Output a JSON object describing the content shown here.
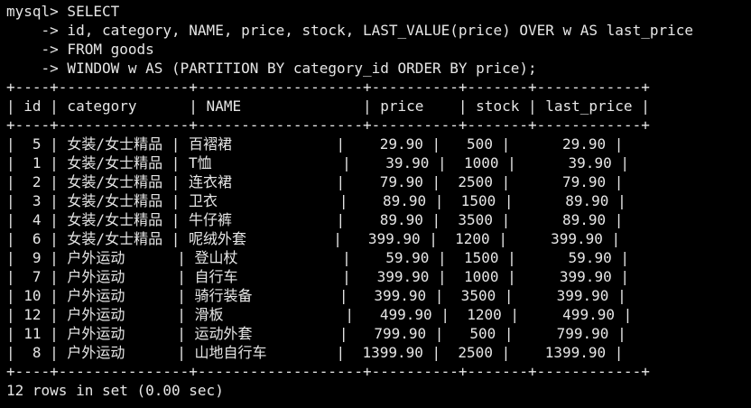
{
  "colors": {
    "background": "#000000",
    "text": "#e6e6e6"
  },
  "query": {
    "line1": "mysql> SELECT",
    "line2": "    -> id, category, NAME, price, stock, LAST_VALUE(price) OVER w AS last_price",
    "line3": "    -> FROM goods",
    "line4": "    -> WINDOW w AS (PARTITION BY category_id ORDER BY price);"
  },
  "table": {
    "border": "+----+---------------+-------------------+----------+-------+------------+",
    "columns": [
      "id",
      "category",
      "NAME",
      "price",
      "stock",
      "last_price"
    ],
    "header_line": "| id | category      | NAME              | price    | stock | last_price |",
    "rows": [
      {
        "id": "5",
        "category": "女装/女士精品",
        "name": "百褶裙",
        "price": "29.90",
        "stock": "500",
        "last_price": "29.90"
      },
      {
        "id": "1",
        "category": "女装/女士精品",
        "name": "T恤",
        "price": "39.90",
        "stock": "1000",
        "last_price": "39.90"
      },
      {
        "id": "2",
        "category": "女装/女士精品",
        "name": "连衣裙",
        "price": "79.90",
        "stock": "2500",
        "last_price": "79.90"
      },
      {
        "id": "3",
        "category": "女装/女士精品",
        "name": "卫衣",
        "price": "89.90",
        "stock": "1500",
        "last_price": "89.90"
      },
      {
        "id": "4",
        "category": "女装/女士精品",
        "name": "牛仔裤",
        "price": "89.90",
        "stock": "3500",
        "last_price": "89.90"
      },
      {
        "id": "6",
        "category": "女装/女士精品",
        "name": "呢绒外套",
        "price": "399.90",
        "stock": "1200",
        "last_price": "399.90"
      },
      {
        "id": "9",
        "category": "户外运动",
        "name": "登山杖",
        "price": "59.90",
        "stock": "1500",
        "last_price": "59.90"
      },
      {
        "id": "7",
        "category": "户外运动",
        "name": "自行车",
        "price": "399.90",
        "stock": "1000",
        "last_price": "399.90"
      },
      {
        "id": "10",
        "category": "户外运动",
        "name": "骑行装备",
        "price": "399.90",
        "stock": "3500",
        "last_price": "399.90"
      },
      {
        "id": "12",
        "category": "户外运动",
        "name": "滑板",
        "price": "499.90",
        "stock": "1200",
        "last_price": "499.90"
      },
      {
        "id": "11",
        "category": "户外运动",
        "name": "运动外套",
        "price": "799.90",
        "stock": "500",
        "last_price": "799.90"
      },
      {
        "id": "8",
        "category": "户外运动",
        "name": "山地自行车",
        "price": "1399.90",
        "stock": "2500",
        "last_price": "1399.90"
      }
    ],
    "row_lines": [
      "|  5 | 女装/女士精品 | 百褶裙            |    29.90 |   500 |      29.90 |",
      "|  1 | 女装/女士精品 | T恤               |    39.90 |  1000 |      39.90 |",
      "|  2 | 女装/女士精品 | 连衣裙            |    79.90 |  2500 |      79.90 |",
      "|  3 | 女装/女士精品 | 卫衣              |    89.90 |  1500 |      89.90 |",
      "|  4 | 女装/女士精品 | 牛仔裤            |    89.90 |  3500 |      89.90 |",
      "|  6 | 女装/女士精品 | 呢绒外套          |   399.90 |  1200 |     399.90 |",
      "|  9 | 户外运动      | 登山杖            |    59.90 |  1500 |      59.90 |",
      "|  7 | 户外运动      | 自行车            |   399.90 |  1000 |     399.90 |",
      "| 10 | 户外运动      | 骑行装备          |   399.90 |  3500 |     399.90 |",
      "| 12 | 户外运动      | 滑板              |   499.90 |  1200 |     499.90 |",
      "| 11 | 户外运动      | 运动外套          |   799.90 |   500 |     799.90 |",
      "|  8 | 户外运动      | 山地自行车        |  1399.90 |  2500 |    1399.90 |"
    ]
  },
  "footer": "12 rows in set (0.00 sec)"
}
